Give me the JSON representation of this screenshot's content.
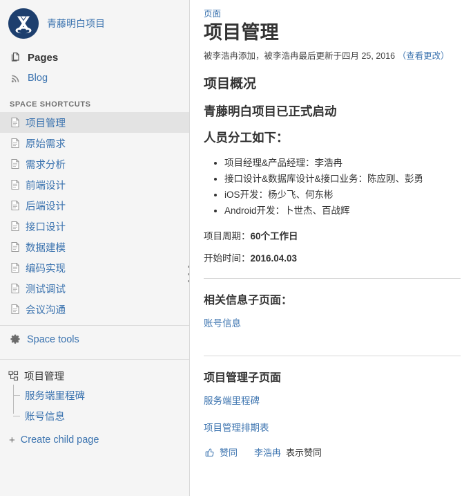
{
  "sidebar": {
    "space": {
      "logo_icon": "space-logo-icon",
      "name": "青藤明白项目"
    },
    "nav": [
      {
        "label": "Pages",
        "icon": "pages-icon"
      },
      {
        "label": "Blog",
        "icon": "rss-icon"
      }
    ],
    "shortcuts_heading": "SPACE SHORTCUTS",
    "shortcuts": [
      {
        "label": "项目管理",
        "icon": "page-icon",
        "selected": true
      },
      {
        "label": "原始需求",
        "icon": "page-icon",
        "selected": false
      },
      {
        "label": "需求分析",
        "icon": "page-icon",
        "selected": false
      },
      {
        "label": "前端设计",
        "icon": "page-icon",
        "selected": false
      },
      {
        "label": "后端设计",
        "icon": "page-icon",
        "selected": false
      },
      {
        "label": "接口设计",
        "icon": "page-icon",
        "selected": false
      },
      {
        "label": "数据建模",
        "icon": "page-icon",
        "selected": false
      },
      {
        "label": "编码实现",
        "icon": "page-icon",
        "selected": false
      },
      {
        "label": "测试调试",
        "icon": "page-icon",
        "selected": false
      },
      {
        "label": "会议沟通",
        "icon": "page-icon",
        "selected": false
      }
    ],
    "space_tools": {
      "label": "Space tools",
      "icon": "gear-icon"
    },
    "tree": {
      "root": {
        "label": "项目管理",
        "icon": "page-tree-icon"
      },
      "children": [
        {
          "label": "服务端里程碑"
        },
        {
          "label": "账号信息"
        }
      ]
    },
    "create_child_page": {
      "label": "Create child page",
      "icon": "plus-icon"
    }
  },
  "main": {
    "breadcrumb": "页面",
    "title": "项目管理",
    "byline_prefix": "被李浩冉添加，被李浩冉最后更新于四月 25, 2016",
    "byline_link": "（查看更改）",
    "sections": {
      "overview_heading": "项目概况",
      "kickoff_heading": "青藤明白项目已正式启动",
      "roles_heading": "人员分工如下：",
      "roles": [
        "项目经理&产品经理：李浩冉",
        "接口设计&数据库设计&接口业务：陈应刚、彭勇",
        "iOS开发：杨少飞、何东彬",
        "Android开发：卜世杰、百战辉"
      ],
      "cycle_label": "项目周期：",
      "cycle_value": "60个工作日",
      "start_label": "开始时间：",
      "start_value": "2016.04.03",
      "related_heading": "相关信息子页面：",
      "related_links": [
        "账号信息"
      ],
      "children_heading": "项目管理子页面",
      "children_links": [
        "服务端里程碑",
        "项目管理排期表"
      ]
    },
    "like": {
      "icon": "thumbs-up-icon",
      "label": "赞同",
      "who": "李浩冉",
      "text": "表示赞同"
    }
  },
  "colors": {
    "link": "#3b73af",
    "logo_bg": "#1d3f6e",
    "sidebar_bg": "#f5f5f5",
    "selected_bg": "#e3e3e3"
  }
}
